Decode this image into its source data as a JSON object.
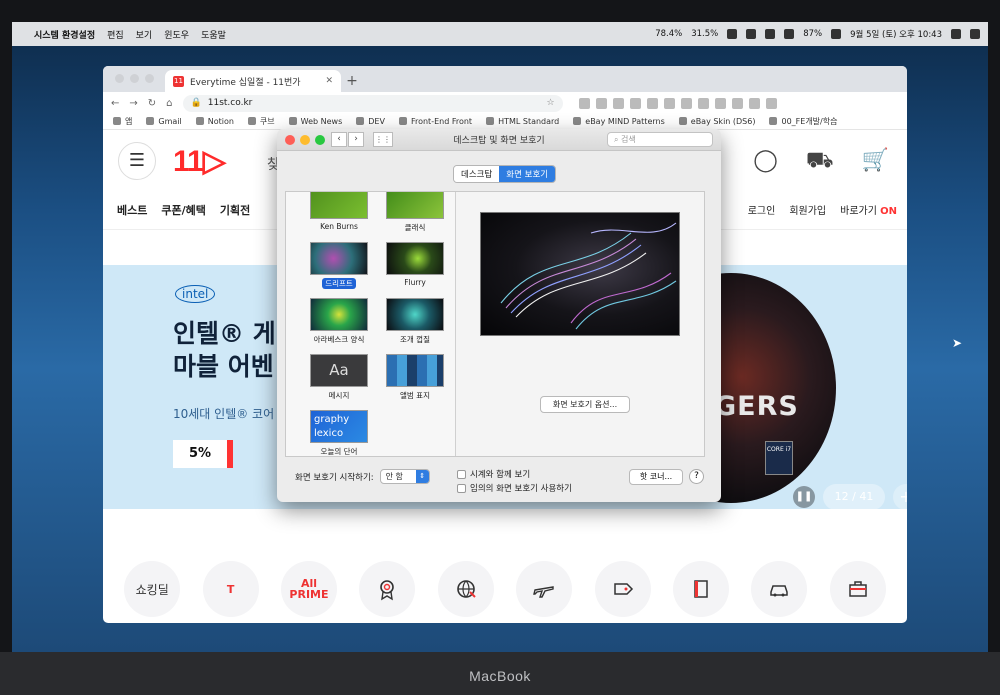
{
  "menubar": {
    "app": "시스템 환경설정",
    "items": [
      "편집",
      "보기",
      "윈도우",
      "도움말"
    ],
    "status": {
      "battery_small": "78.4%",
      "percent2": "31.5%",
      "wifi_battery": "87%",
      "datetime": "9월 5일 (토) 오후 10:43"
    }
  },
  "chrome": {
    "tab_title": "Everytime 십일절 - 11번가",
    "url": "11st.co.kr",
    "bookmarks": [
      "앱",
      "Gmail",
      "Notion",
      "쿠브",
      "Web News",
      "DEV",
      "Front-End Front",
      "HTML Standard",
      "eBay MIND Patterns",
      "eBay Skin (DS6)",
      "00_FE개발/학습"
    ]
  },
  "site": {
    "logo": "11",
    "search_frag": "찾",
    "nav": [
      "베스트",
      "쿠폰/혜택",
      "기획전"
    ],
    "nav_right": {
      "login": "로그인",
      "signup": "회원가입",
      "shortcut": "바로가기",
      "on": "ON"
    },
    "banner": {
      "intel": "intel",
      "line1": "인텔® 게",
      "line2": "마블 어벤",
      "sub": "10세대 인텔® 코어",
      "discount": "5%",
      "avengers_title": "GERS",
      "core": "CORE i7",
      "page": "12 / 41"
    },
    "icon_row": [
      {
        "name": "shopping-deal",
        "label": "쇼킹딜"
      },
      {
        "name": "t-icon",
        "label": ""
      },
      {
        "name": "all-prime",
        "label": "All PRIME"
      },
      {
        "name": "medal-icon",
        "label": ""
      },
      {
        "name": "globe-icon",
        "label": ""
      },
      {
        "name": "plane-icon",
        "label": ""
      },
      {
        "name": "tag-icon",
        "label": ""
      },
      {
        "name": "book-icon",
        "label": ""
      },
      {
        "name": "car-icon",
        "label": ""
      },
      {
        "name": "bag-icon",
        "label": ""
      }
    ]
  },
  "prefs": {
    "title": "데스크탑 및 화면 보호기",
    "search_placeholder": "검색",
    "tabs": [
      "데스크탑",
      "화면 보호기"
    ],
    "active_tab": "화면 보호기",
    "savers": [
      {
        "label": "Ken Burns"
      },
      {
        "label": "클래식"
      },
      {
        "label": "드리프트",
        "selected": true
      },
      {
        "label": "Flurry"
      },
      {
        "label": "아라베스크 양식"
      },
      {
        "label": "조개 껍질"
      },
      {
        "label": "메시지"
      },
      {
        "label": "앨범 표지"
      },
      {
        "label": "오늘의 단어"
      }
    ],
    "options_button": "화면 보호기 옵션...",
    "start_after_label": "화면 보호기 시작하기:",
    "start_after_value": "안 함",
    "show_clock": "시계와 함께 보기",
    "random": "임의의 화면 보호기 사용하기",
    "hot_corners": "핫 코너...",
    "help": "?"
  },
  "laptop": {
    "brand": "MacBook"
  },
  "colors": {
    "accent": "#2f7de1",
    "brand_red": "#ff2b2b"
  }
}
